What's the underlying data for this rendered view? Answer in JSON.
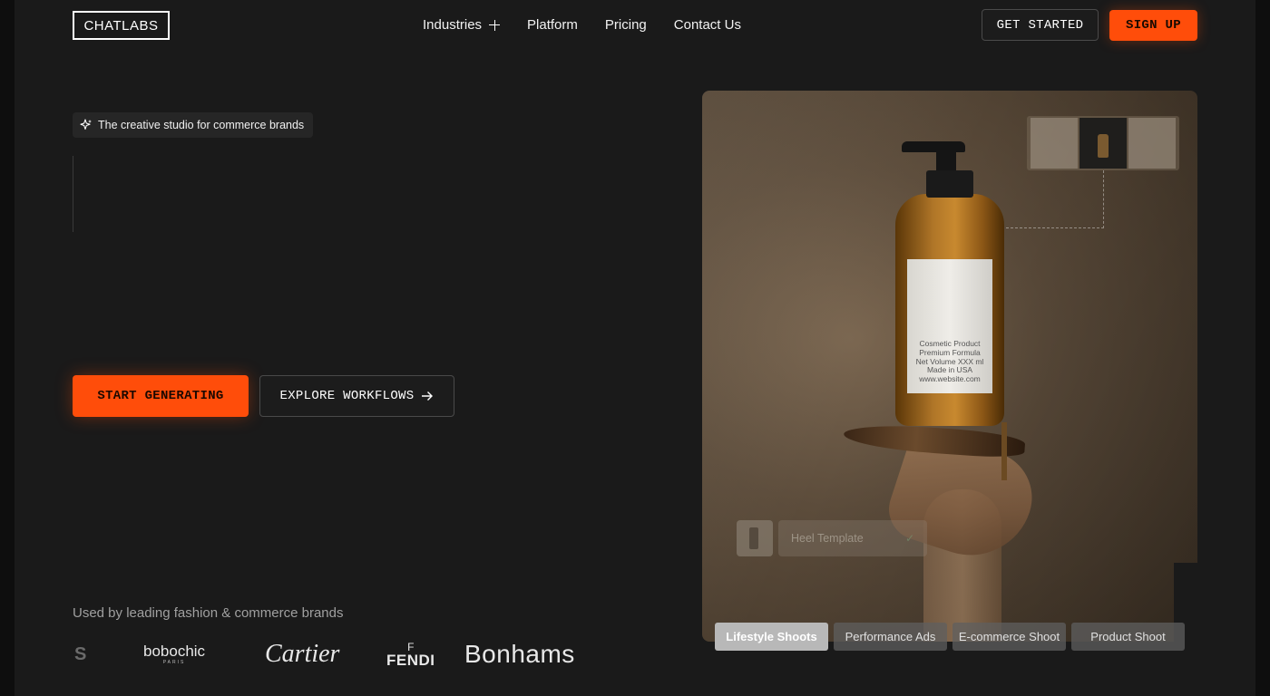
{
  "header": {
    "logo": "CHATLABS",
    "nav": [
      {
        "label": "Industries"
      },
      {
        "label": "Platform"
      },
      {
        "label": "Pricing"
      },
      {
        "label": "Contact Us"
      }
    ],
    "get_started": "GET STARTED",
    "sign_up": "SIGN UP"
  },
  "hero": {
    "tagline": "The creative studio for commerce brands",
    "primary_cta": "START GENERATING",
    "secondary_cta": "EXPLORE WORKFLOWS"
  },
  "brands": {
    "heading": "Used by leading fashion & commerce brands",
    "items": {
      "partial": "S",
      "bobochic": "bobochic",
      "bobochic_sub": "PARIS",
      "cartier": "Cartier",
      "fendi_mark": "F",
      "fendi": "FENDI",
      "bonhams": "Bonhams"
    }
  },
  "preview": {
    "bottle_label": [
      "Cosmetic Product",
      "Premium Formula",
      "Net Volume XXX ml",
      "Made in USA",
      "www.website.com"
    ],
    "template_label": "Heel Template",
    "tabs": [
      {
        "label": "Lifestyle Shoots",
        "active": true
      },
      {
        "label": "Performance Ads",
        "active": false
      },
      {
        "label": "E-commerce Shoot",
        "active": false
      },
      {
        "label": "Product Shoot",
        "active": false
      }
    ]
  },
  "colors": {
    "accent": "#ff4d0a",
    "background": "#1a1a1a"
  },
  "icons": {
    "industries": "plus-icon",
    "tagline": "sparkle-icon",
    "explore": "arrow-right-icon"
  }
}
